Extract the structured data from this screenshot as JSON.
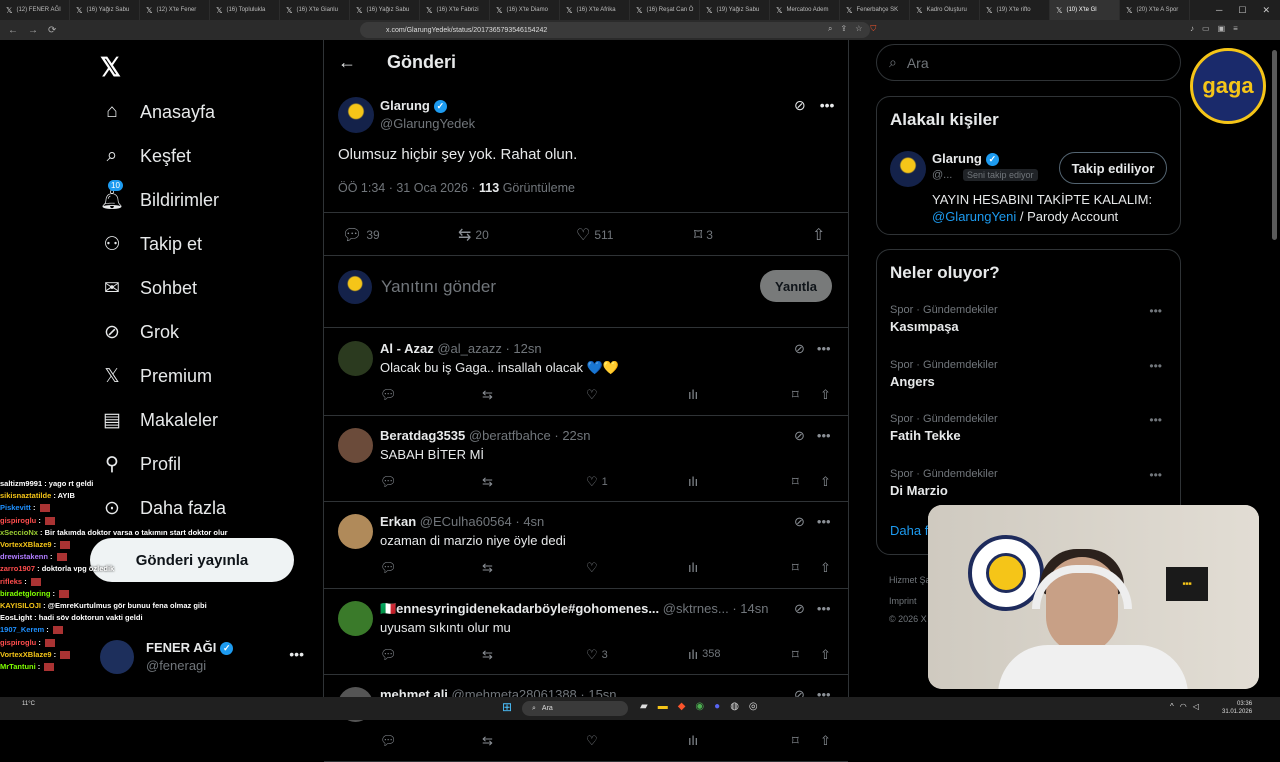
{
  "browser": {
    "tabs": [
      {
        "label": "(12) FENER AĞI"
      },
      {
        "label": "(16) Yağız Sabu"
      },
      {
        "label": "(12) X'te Fener"
      },
      {
        "label": "(16) Toplulukla"
      },
      {
        "label": "(16) X'te Gianlu"
      },
      {
        "label": "(16) Yağız Sabu"
      },
      {
        "label": "(16) X'te Fabrizi"
      },
      {
        "label": "(16) X'te Diamo"
      },
      {
        "label": "(16) X'te Afrika"
      },
      {
        "label": "(16) Reşat Can Ö"
      },
      {
        "label": "(19) Yağız Sabu"
      },
      {
        "label": "Mercatoo Adem"
      },
      {
        "label": "Fenerbahçe SK"
      },
      {
        "label": "Kadro Oluşturu"
      },
      {
        "label": "(19) X'te rifto"
      },
      {
        "label": "(10) X'te Gl"
      },
      {
        "label": "(20) X'te A Spor"
      }
    ],
    "url": "x.com/GlarungYedek/status/2017365793546154242"
  },
  "nav": {
    "items": [
      {
        "label": "Anasayfa",
        "icon": "home-icon"
      },
      {
        "label": "Keşfet",
        "icon": "search-icon"
      },
      {
        "label": "Bildirimler",
        "icon": "bell-icon",
        "badge": "10"
      },
      {
        "label": "Takip et",
        "icon": "add-user-icon"
      },
      {
        "label": "Sohbet",
        "icon": "mail-icon"
      },
      {
        "label": "Grok",
        "icon": "grok-icon"
      },
      {
        "label": "Premium",
        "icon": "x-icon"
      },
      {
        "label": "Makaleler",
        "icon": "article-icon"
      },
      {
        "label": "Profil",
        "icon": "person-icon"
      },
      {
        "label": "Daha fazla",
        "icon": "more-circle-icon"
      }
    ],
    "post_button": "Gönderi yayınla",
    "account": {
      "name": "FENER AĞI",
      "handle": "@feneragi"
    }
  },
  "chat": [
    {
      "user": "saltizm9991",
      "color": "#ffffff",
      "msg": "yago rt geldi"
    },
    {
      "user": "sikisnaztatilde",
      "color": "#f5c518",
      "msg": "AYIB"
    },
    {
      "user": "Piskevitt",
      "color": "#1e90ff",
      "msg": ""
    },
    {
      "user": "gispiroglu",
      "color": "#ff4d4d",
      "msg": ""
    },
    {
      "user": "xSeccioNx",
      "color": "#9acd32",
      "msg": "Bir takımda doktor varsa o takımın start doktor olur"
    },
    {
      "user": "VortexXBlaze9",
      "color": "#f5c518",
      "msg": ""
    },
    {
      "user": "drewistakenn",
      "color": "#b07cff",
      "msg": ""
    },
    {
      "user": "zarro1907",
      "color": "#ff4d4d",
      "msg": "doktorla vpg özledik"
    },
    {
      "user": "rifleks",
      "color": "#ff4d4d",
      "msg": ""
    },
    {
      "user": "biradetgloring",
      "color": "#7fff00",
      "msg": ""
    },
    {
      "user": "KAYISILOJI",
      "color": "#f5c518",
      "msg": "@EmreKurtulmus gör bunuu fena olmaz gibi"
    },
    {
      "user": "EosLight",
      "color": "#ffffff",
      "msg": "hadi söv doktorun vakti geldi"
    },
    {
      "user": "1907_Kerem",
      "color": "#1e90ff",
      "msg": ""
    },
    {
      "user": "gispiroglu",
      "color": "#ff4d4d",
      "msg": ""
    },
    {
      "user": "VortexXBlaze9",
      "color": "#f5c518",
      "msg": ""
    },
    {
      "user": "MrTantuni",
      "color": "#7fff00",
      "msg": ""
    }
  ],
  "main": {
    "header_title": "Gönderi",
    "post": {
      "name": "Glarung",
      "handle": "@GlarungYedek",
      "text": "Olumsuz hiçbir şey yok. Rahat olun.",
      "time": "ÖÖ 1:34 · 31 Oca 2026 · ",
      "views": "113",
      "views_label": " Görüntüleme",
      "replies": "39",
      "reposts": "20",
      "likes": "511",
      "bookmarks": "3"
    },
    "reply_placeholder": "Yanıtını gönder",
    "reply_button": "Yanıtla",
    "replies": [
      {
        "name": "Al - Azaz",
        "handle": "@al_azazz",
        "time": "· 12sn",
        "text": "Olacak bu iş Gaga.. insallah olacak 💙💛",
        "likes": "",
        "views": "",
        "avatar": "#2b3a1f"
      },
      {
        "name": "Beratdag3535",
        "handle": "@beratfbahce",
        "time": "· 22sn",
        "text": "SABAH BİTER Mİ",
        "likes": "1",
        "views": "",
        "avatar": "#6b4b3a"
      },
      {
        "name": "Erkan",
        "handle": "@ECulha60564",
        "time": "· 4sn",
        "text": "ozaman di marzio niye öyle dedi",
        "likes": "",
        "views": "",
        "avatar": "#b08a5a"
      },
      {
        "name": "🇮🇹ennesyringidenekadarböyle#gohomenes...",
        "handle": "@sktrnes...",
        "time": "· 14sn",
        "text": "uyusam sıkıntı olur mu",
        "likes": "3",
        "views": "358",
        "avatar": "#3a7a2a"
      },
      {
        "name": "mehmet ali",
        "handle": "@mehmeta28061388",
        "time": "· 15sn",
        "text": "",
        "likes": "",
        "views": "",
        "avatar": "#555"
      }
    ]
  },
  "right": {
    "search_placeholder": "Ara",
    "related_title": "Alakalı kişiler",
    "related": {
      "name": "Glarung",
      "handle": "@...",
      "follows_you": "Seni takip ediyor",
      "button": "Takip ediliyor",
      "bio_text": "YAYIN HESABINI TAKİPTE KALALIM:",
      "bio_link": "@GlarungYeni",
      "bio_rest": " / Parody Account"
    },
    "trends_title": "Neler oluyor?",
    "trends": [
      {
        "category": "Spor · Gündemdekiler",
        "name": "Kasımpaşa"
      },
      {
        "category": "Spor · Gündemdekiler",
        "name": "Angers"
      },
      {
        "category": "Spor · Gündemdekiler",
        "name": "Fatih Tekke"
      },
      {
        "category": "Spor · Gündemdekiler",
        "name": "Di Marzio"
      }
    ],
    "show_more": "Daha fazla göster",
    "footer1": "Hizmet Şartları",
    "footer2": "Imprint",
    "footer3": "© 2026 X Corp."
  },
  "overlay": {
    "gaga_logo": "gaga"
  },
  "taskbar": {
    "search": "Ara",
    "time": "03:36",
    "date": "31.01.2026",
    "weather": "11°C"
  }
}
